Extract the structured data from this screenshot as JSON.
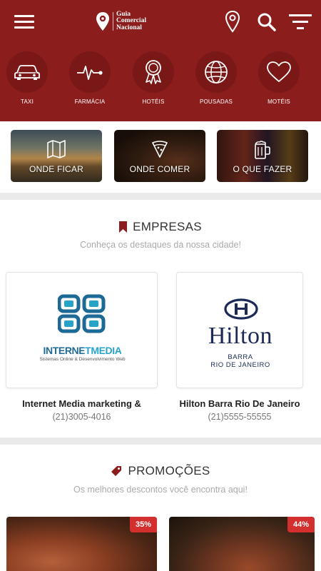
{
  "header": {
    "logo": {
      "line1": "Guia",
      "line2": "Comercial",
      "line3": "Nacional"
    },
    "icons": [
      "menu-icon",
      "location-pin-icon",
      "search-icon",
      "filter-icon"
    ],
    "categories": [
      {
        "label": "TAXI",
        "icon": "car-icon"
      },
      {
        "label": "FARMÁCIA",
        "icon": "pulse-icon"
      },
      {
        "label": "HOTÉIS",
        "icon": "award-icon"
      },
      {
        "label": "POUSADAS",
        "icon": "globe-icon"
      },
      {
        "label": "MOTÉIS",
        "icon": "heart-icon"
      }
    ]
  },
  "quick": [
    {
      "label": "ONDE FICAR",
      "icon": "map-icon"
    },
    {
      "label": "ONDE COMER",
      "icon": "pizza-slice-icon"
    },
    {
      "label": "O QUE FAZER",
      "icon": "beer-mug-icon"
    }
  ],
  "empresas": {
    "title": "EMPRESAS",
    "subtitle": "Conheça os destaques da nossa cidade!",
    "items": [
      {
        "name": "Internet Media marketing &",
        "phone": "(21)3005-4016",
        "logo": {
          "brand": "INTERNETMEDIA",
          "tagline": "Sistemas Online & Desenvolvimento Web"
        }
      },
      {
        "name": "Hilton Barra Rio De Janeiro",
        "phone": "(21)5555-55555",
        "logo": {
          "brand": "Hilton",
          "line1": "BARRA",
          "line2": "RIO DE JANEIRO"
        }
      }
    ]
  },
  "promocoes": {
    "title": "PROMOÇÕES",
    "subtitle": "Os melhores descontos você encontra aqui!",
    "items": [
      {
        "discount": "35%"
      },
      {
        "discount": "44%"
      }
    ]
  },
  "colors": {
    "primary": "#8c1d1d",
    "badge": "#d32f2f",
    "hilton_navy": "#1b2a57",
    "im_blue": "#1e6a96",
    "im_cyan": "#27a3c8"
  }
}
